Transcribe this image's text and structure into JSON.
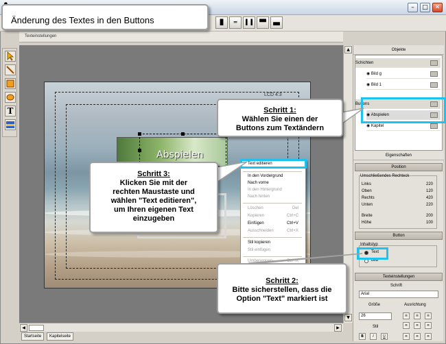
{
  "window": {
    "app_letter": "A",
    "minimize": "–",
    "maximize": "□",
    "close": "✕"
  },
  "title_callout": "Änderung des Textes in den Buttons",
  "toolbar": {
    "icons": [
      "align-icon",
      "align-icon",
      "align-icon",
      "align-icon",
      "align-icon",
      "align-icon",
      "grid-icon"
    ]
  },
  "subtab": "Texteinstellungen",
  "canvas": {
    "button_text": "Abspielen",
    "corner_label": "LCD 4:3"
  },
  "context_menu": {
    "items": [
      {
        "label": "Text editieren",
        "shortcut": "",
        "disabled": false
      },
      {
        "label": "In den Vordergrund",
        "shortcut": "",
        "disabled": false
      },
      {
        "label": "Nach vorne",
        "shortcut": "",
        "disabled": false
      },
      {
        "label": "In den Hintergrund",
        "shortcut": "",
        "disabled": true
      },
      {
        "label": "Nach hinten",
        "shortcut": "",
        "disabled": true
      },
      {
        "label": "Löschen",
        "shortcut": "Del",
        "disabled": true
      },
      {
        "label": "Kopieren",
        "shortcut": "Ctrl+C",
        "disabled": true
      },
      {
        "label": "Einfügen",
        "shortcut": "Ctrl+V",
        "disabled": false
      },
      {
        "label": "Ausschneiden",
        "shortcut": "Ctrl+X",
        "disabled": true
      },
      {
        "label": "Stil kopieren",
        "shortcut": "",
        "disabled": false
      },
      {
        "label": "Stil einfügen",
        "shortcut": "",
        "disabled": true
      },
      {
        "label": "Umbenennen",
        "shortcut": "Ctrl+R",
        "disabled": true
      }
    ]
  },
  "callouts": {
    "step1": {
      "heading": "Schritt 1",
      "colon": ":",
      "line1": "Wählen Sie einen der",
      "line2": "Buttons zum Textändern"
    },
    "step2": {
      "heading": "Schritt 2",
      "colon": ":",
      "line1": "Bitte sicherstellen, dass die",
      "line2": "Option \"Text\" markiert ist"
    },
    "step3": {
      "heading": "Schritt 3",
      "colon": ":",
      "line1": "Klicken Sie mit der",
      "line2": "rechten Maustaste und",
      "line3": "wählen \"Text editieren\",",
      "line4": "um Ihren eigenen Text",
      "line5": "einzugeben"
    }
  },
  "page_tabs": [
    "Startseite",
    "Kapitelseite"
  ],
  "right_panel": {
    "objects_header": "Objekte",
    "layers": {
      "group": "Schichten",
      "items": [
        "Bild g",
        "Bild 1"
      ]
    },
    "buttons": {
      "group": "Buttons",
      "items": [
        "Abspielen",
        "Kapitel"
      ]
    },
    "properties_header": "Eigenschaften",
    "position": {
      "header": "Position",
      "group": "Umschließendes Rechteck",
      "rows": [
        {
          "label": "Links",
          "value": "220"
        },
        {
          "label": "Oben",
          "value": "120"
        },
        {
          "label": "Rechts",
          "value": "420"
        },
        {
          "label": "Unten",
          "value": "220"
        },
        {
          "label": "Breite",
          "value": "200"
        },
        {
          "label": "Höhe",
          "value": "100"
        }
      ]
    },
    "button": {
      "header": "Button",
      "group": "Inhaltstyp",
      "opt_text": "Text",
      "opt_image": "Bild"
    },
    "text_settings": {
      "header": "Texteinstellungen",
      "font_label": "Schrift",
      "font_value": "Arial",
      "size_label": "Größe",
      "size_value": "26",
      "align_label": "Ausrichtung",
      "style_label": "Stil"
    }
  }
}
